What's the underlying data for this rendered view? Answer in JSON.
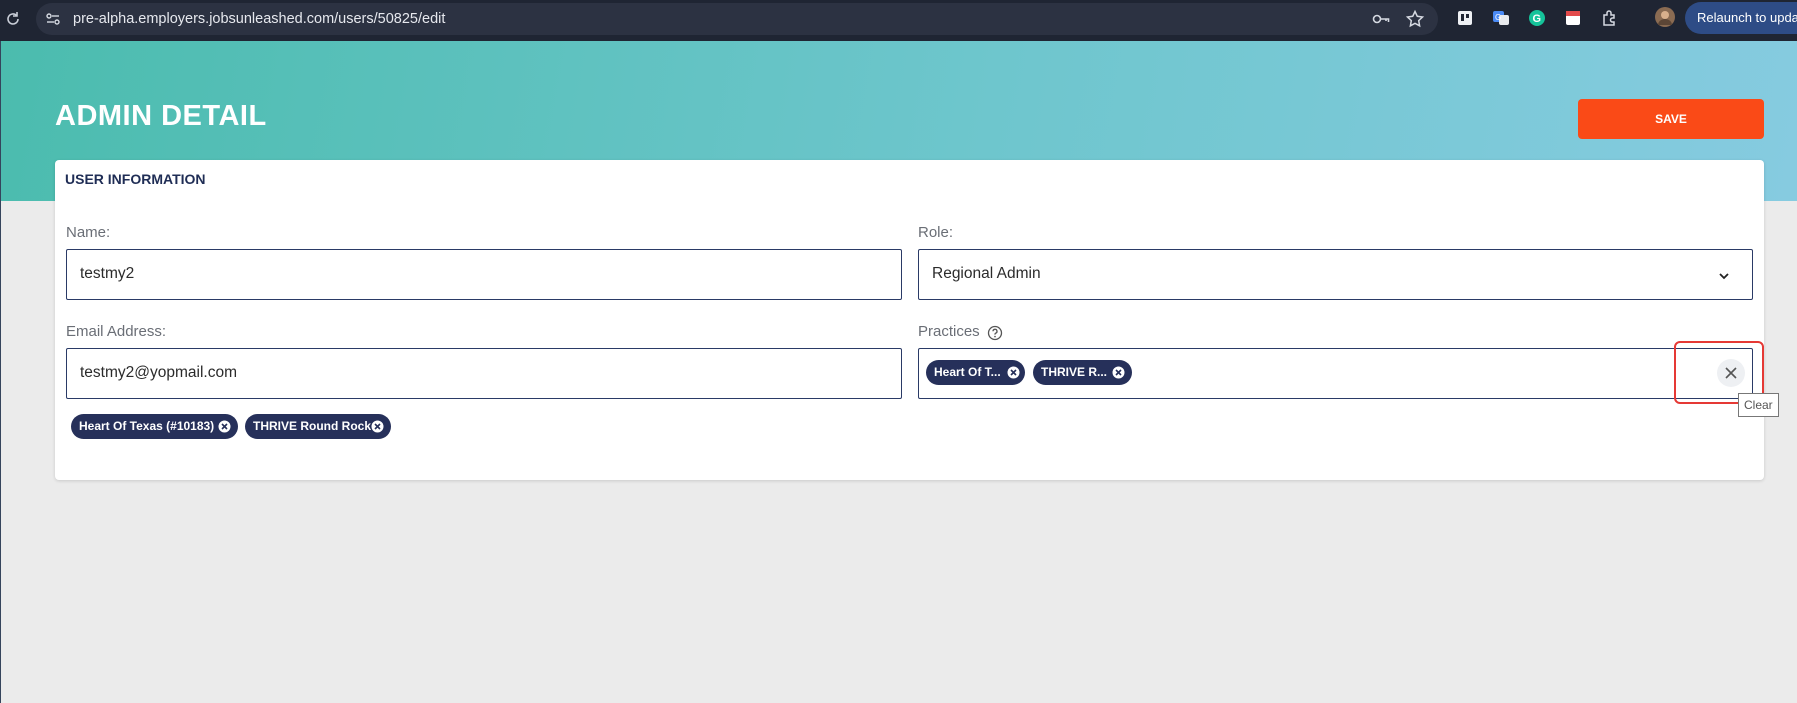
{
  "browser": {
    "url": "pre-alpha.employers.jobsunleashed.com/users/50825/edit",
    "relaunch_label": "Relaunch to update"
  },
  "page": {
    "title": "ADMIN DETAIL",
    "save_label": "SAVE"
  },
  "card": {
    "title": "USER INFORMATION",
    "name_label": "Name:",
    "name_value": "testmy2",
    "role_label": "Role:",
    "role_value": "Regional Admin",
    "email_label": "Email Address:",
    "email_value": "testmy2@yopmail.com",
    "practices_label": "Practices",
    "practice_chips_truncated": [
      "Heart Of T...",
      "THRIVE R..."
    ],
    "practice_chips_full": [
      "Heart Of Texas (#10183)",
      "THRIVE Round Rock"
    ],
    "clear_tooltip": "Clear"
  },
  "colors": {
    "accent": "#fa4a17",
    "chip": "#26305a",
    "highlight": "#e53935",
    "hero_start": "#4bbcae",
    "hero_end": "#86cbe0"
  },
  "icons": [
    "reload-icon",
    "site-settings-icon",
    "password-key-icon",
    "bookmark-star-icon",
    "chevron-down-icon",
    "help-circle-icon",
    "chip-remove-icon",
    "clear-icon"
  ]
}
